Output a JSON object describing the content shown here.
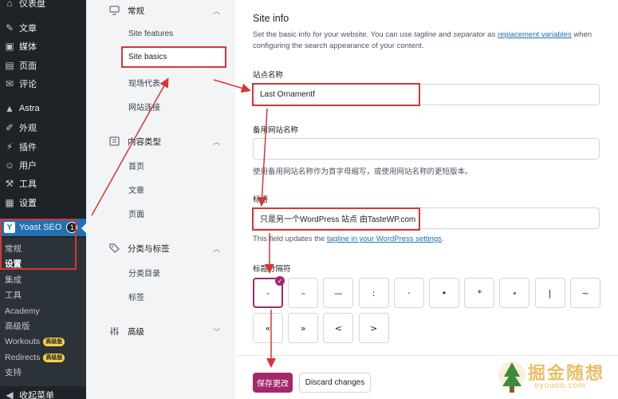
{
  "wp_sidebar": {
    "items": [
      {
        "icon": "dashboard-icon",
        "label": "仪表盘"
      },
      {
        "icon": "pin-icon",
        "label": "文章"
      },
      {
        "icon": "media-icon",
        "label": "媒体"
      },
      {
        "icon": "page-icon",
        "label": "页面"
      },
      {
        "icon": "comment-icon",
        "label": "评论"
      },
      {
        "icon": "astra-icon",
        "label": "Astra"
      },
      {
        "icon": "brush-icon",
        "label": "外观"
      },
      {
        "icon": "plug-icon",
        "label": "插件"
      },
      {
        "icon": "user-icon",
        "label": "用户"
      },
      {
        "icon": "wrench-icon",
        "label": "工具"
      },
      {
        "icon": "settings-icon",
        "label": "设置"
      }
    ],
    "yoast": {
      "label": "Yoast SEO",
      "count": "1"
    },
    "submenu": [
      {
        "label": "常规",
        "badge": ""
      },
      {
        "label": "设置",
        "badge": ""
      },
      {
        "label": "集成",
        "badge": ""
      },
      {
        "label": "工具",
        "badge": ""
      },
      {
        "label": "Academy",
        "badge": ""
      },
      {
        "label": "高级版",
        "badge": ""
      },
      {
        "label": "Workouts",
        "badge": "高级版"
      },
      {
        "label": "Redirects",
        "badge": "高级版"
      },
      {
        "label": "支持",
        "badge": ""
      }
    ],
    "collapse_label": "收起菜单"
  },
  "settings_nav": {
    "groups": [
      {
        "icon": "monitor-icon",
        "label": "常规",
        "links": [
          "Site features",
          "Site basics",
          "现场代表",
          "网站连接"
        ]
      },
      {
        "icon": "content-types-icon",
        "label": "内容类型",
        "links": [
          "首页",
          "文章",
          "页面"
        ]
      },
      {
        "icon": "tag-icon",
        "label": "分类与标签",
        "links": [
          "分类目录",
          "标签"
        ]
      },
      {
        "icon": "sliders-icon",
        "label": "高级",
        "links": []
      }
    ],
    "active": "Site basics"
  },
  "main": {
    "title": "Site info",
    "desc_1": "Set the basic info for your website. You can use ",
    "desc_tagline": "tagline",
    "desc_2": " and ",
    "desc_separator": "separator",
    "desc_3": " as ",
    "desc_link": "replacement variables",
    "desc_4": " when configuring the search appearance of your content.",
    "site_name_label": "站点名称",
    "site_name_value": "Last Ornamentf",
    "alt_name_label": "备用网站名称",
    "alt_name_value": "",
    "alt_name_help": "使用备用网站名称作为首字母缩写，或使用网站名称的更短版本。",
    "tagline_label": "标语",
    "tagline_value": "只是另一个WordPress 站点 由TasteWP.com",
    "tagline_help_1": "This field updates the ",
    "tagline_help_link": "tagline in your WordPress settings",
    "tagline_help_2": ".",
    "separator_label": "标题分隔符",
    "separators": [
      "-",
      "–",
      "—",
      ":",
      "·",
      "•",
      "*",
      "⋆",
      "|",
      "~",
      "«",
      "»",
      "<",
      ">"
    ],
    "separator_selected": "-",
    "save_label": "保存更改",
    "discard_label": "Discard changes"
  },
  "watermark": {
    "title": "掘金随想",
    "sub": "oyouoo.com"
  },
  "colors": {
    "wp_sidebar": "#1d2327",
    "yoast_accent": "#a4286a",
    "wp_blue": "#2271b1",
    "annotation_red": "#d63638"
  }
}
